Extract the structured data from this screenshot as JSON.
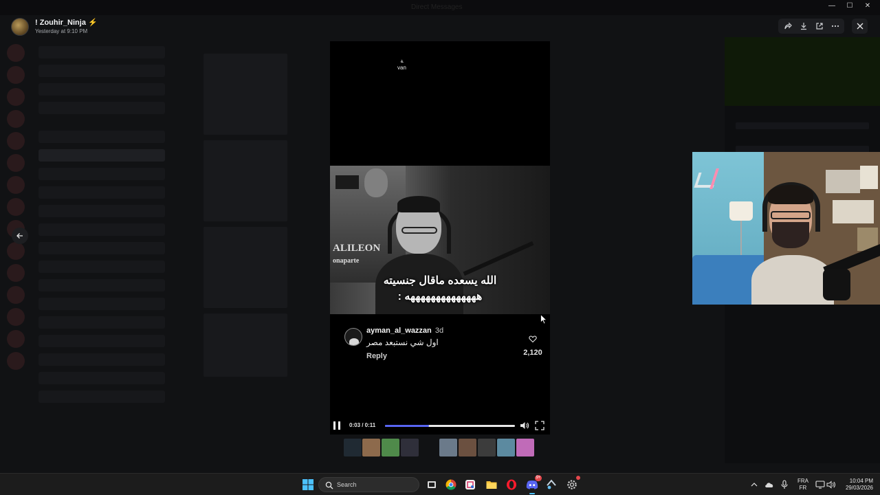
{
  "window": {
    "title_center": "Direct Messages"
  },
  "header": {
    "username": "! Zouhir_Ninja ⚡",
    "timestamp": "Yesterday at 9:10 PM"
  },
  "video": {
    "top_text": "ﺔ\nvan",
    "caption_line1": "الله يسعده ماقال جنسيته",
    "caption_line2": "ههههههههههههههه :",
    "comment": {
      "username": "ayman_al_wazzan",
      "age": "3d",
      "text": "اول شي نستبعد مصر",
      "reply_label": "Reply",
      "like_count": "2,120"
    },
    "player": {
      "time": "0:03 / 0:11",
      "progress": 0.34
    }
  },
  "thumbnails": [
    {
      "color": "#2c3a48"
    },
    {
      "color": "#8d6a4c"
    },
    {
      "color": "#4f8a4a"
    },
    {
      "color": "#2f2f3a"
    },
    {
      "color": "#6b7a8a"
    },
    {
      "color": "#6b5040"
    },
    {
      "color": "#3c3c3c"
    },
    {
      "color": "#5c8aa0"
    },
    {
      "color": "#c06bb8"
    },
    {
      "color": "#c6a860"
    }
  ],
  "taskbar": {
    "search_placeholder": "Search",
    "discord_badge": "9+",
    "lang_top": "FRA",
    "lang_bottom": "FR",
    "time": "10:04 PM",
    "date": "29/03/2026"
  },
  "colors": {
    "accent": "#5865f2",
    "taskbar": "#1c1c1c"
  }
}
